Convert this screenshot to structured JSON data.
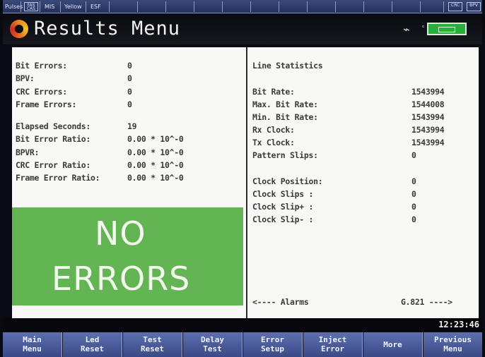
{
  "status_bar": {
    "items": [
      "Pulses",
      "MIS",
      "Yellow",
      "ESF"
    ],
    "icon_left_label": "FAS CAS",
    "icon_right_labels": [
      "CRC",
      "BPV"
    ]
  },
  "title": "Results Menu",
  "left_stats": [
    {
      "label": "Bit Errors:",
      "value": "0"
    },
    {
      "label": "BPV:",
      "value": "0"
    },
    {
      "label": "CRC Errors:",
      "value": "0"
    },
    {
      "label": "Frame Errors:",
      "value": "0"
    },
    {
      "label": "Elapsed Seconds:",
      "value": "19"
    },
    {
      "label": "Bit Error Ratio:",
      "value": "0.00 * 10^-0"
    },
    {
      "label": "BPVR:",
      "value": "0.00 * 10^-0"
    },
    {
      "label": "CRC Error Ratio:",
      "value": "0.00 * 10^-0"
    },
    {
      "label": "Frame Error Ratio:",
      "value": "0.00 * 10^-0"
    }
  ],
  "no_errors": {
    "line1": "NO",
    "line2": "ERRORS",
    "color": "#63b553"
  },
  "right_header": "Line Statistics",
  "right_stats": [
    {
      "label": "Bit Rate:",
      "value": "1543994"
    },
    {
      "label": "Max. Bit Rate:",
      "value": "1544008"
    },
    {
      "label": "Min. Bit Rate:",
      "value": "1543994"
    },
    {
      "label": "Rx Clock:",
      "value": "1543994"
    },
    {
      "label": "Tx Clock:",
      "value": "1543994"
    },
    {
      "label": "Pattern Slips:",
      "value": "0"
    },
    {
      "label": "Clock Position:",
      "value": "0"
    },
    {
      "label": "Clock Slips :",
      "value": "0"
    },
    {
      "label": "Clock Slip+ :",
      "value": "0"
    },
    {
      "label": "Clock Slip- :",
      "value": "0"
    }
  ],
  "nav": {
    "alarms": "<---- Alarms",
    "g821": "G.821 ---->"
  },
  "clock": "12:23:46",
  "softkeys": [
    {
      "line1": "Main",
      "line2": "Menu"
    },
    {
      "line1": "Led",
      "line2": "Reset"
    },
    {
      "line1": "Test",
      "line2": "Reset"
    },
    {
      "line1": "Delay",
      "line2": "Test"
    },
    {
      "line1": "Error",
      "line2": "Setup"
    },
    {
      "line1": "Inject",
      "line2": "Error"
    },
    {
      "line1": "More",
      "line2": ""
    },
    {
      "line1": "Previous",
      "line2": "Menu"
    }
  ]
}
